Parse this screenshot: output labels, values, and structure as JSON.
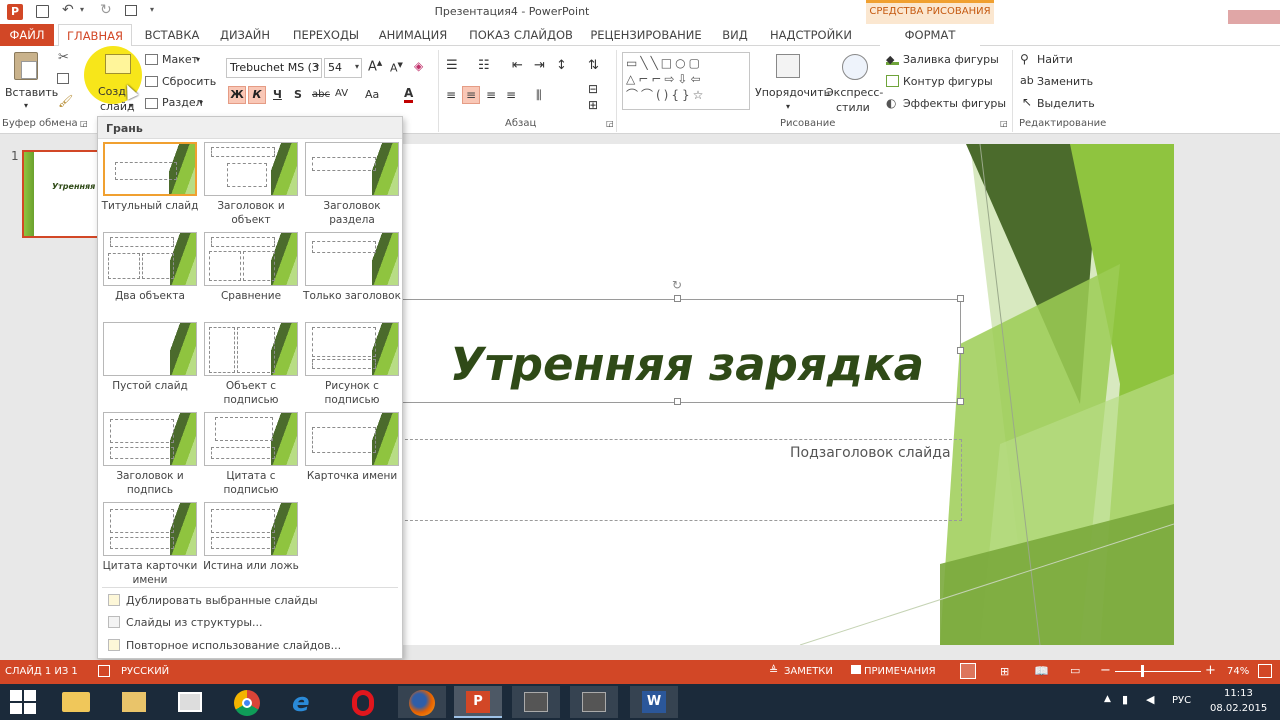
{
  "window": {
    "title": "Презентация4 - PowerPoint",
    "context_group": "СРЕДСТВА РИСОВАНИЯ"
  },
  "tabs": [
    "ФАЙЛ",
    "ГЛАВНАЯ",
    "ВСТАВКА",
    "ДИЗАЙН",
    "ПЕРЕХОДЫ",
    "АНИМАЦИЯ",
    "ПОКАЗ СЛАЙДОВ",
    "РЕЦЕНЗИРОВАНИЕ",
    "ВИД",
    "НАДСТРОЙКИ",
    "ФОРМАТ"
  ],
  "ribbon": {
    "paste": "Вставить",
    "new_slide_1": "Созд",
    "new_slide_2": "слайд",
    "layout": "Макет",
    "reset": "Сбросить",
    "section": "Раздел",
    "clipboard_group": "Буфер обмена",
    "font_name": "Trebuchet MS (З",
    "font_size": "54",
    "bold": "Ж",
    "italic": "К",
    "underline": "Ч",
    "strike": "S",
    "shadow": "abc",
    "spacing": "AV",
    "case": "Aa",
    "paragraph_group": "Абзац",
    "drawing_group": "Рисование",
    "arrange": "Упорядочить",
    "quick_styles_1": "Экспресс-",
    "quick_styles_2": "стили",
    "shape_fill": "Заливка фигуры",
    "shape_outline": "Контур фигуры",
    "shape_effects": "Эффекты фигуры",
    "find": "Найти",
    "replace": "Заменить",
    "select": "Выделить",
    "editing_group": "Редактирование"
  },
  "dropdown": {
    "theme_name": "Грань",
    "layouts": [
      "Титульный слайд",
      "Заголовок и объект",
      "Заголовок раздела",
      "Два объекта",
      "Сравнение",
      "Только заголовок",
      "Пустой слайд",
      "Объект с подписью",
      "Рисунок с подписью",
      "Заголовок и подпись",
      "Цитата с подписью",
      "Карточка имени",
      "Цитата карточки имени",
      "Истина или ложь"
    ],
    "actions": [
      "Дублировать выбранные слайды",
      "Слайды из структуры...",
      "Повторное использование слайдов..."
    ]
  },
  "thumbnail": {
    "number": "1",
    "title": "Утренняя"
  },
  "slide": {
    "title": "Утренняя зарядка",
    "subtitle": "Подзаголовок слайда"
  },
  "status": {
    "slide_info": "СЛАЙД 1 ИЗ 1",
    "language": "РУССКИЙ",
    "notes": "ЗАМЕТКИ",
    "comments": "ПРИМЕЧАНИЯ",
    "zoom": "74%"
  },
  "taskbar": {
    "lang": "РУС",
    "time": "11:13",
    "date": "08.02.2015"
  },
  "colors": {
    "accent": "#d24726",
    "slide_green_dark": "#3b5e1a",
    "slide_green_light": "#8fc43f",
    "title_text": "#2f4a17"
  }
}
